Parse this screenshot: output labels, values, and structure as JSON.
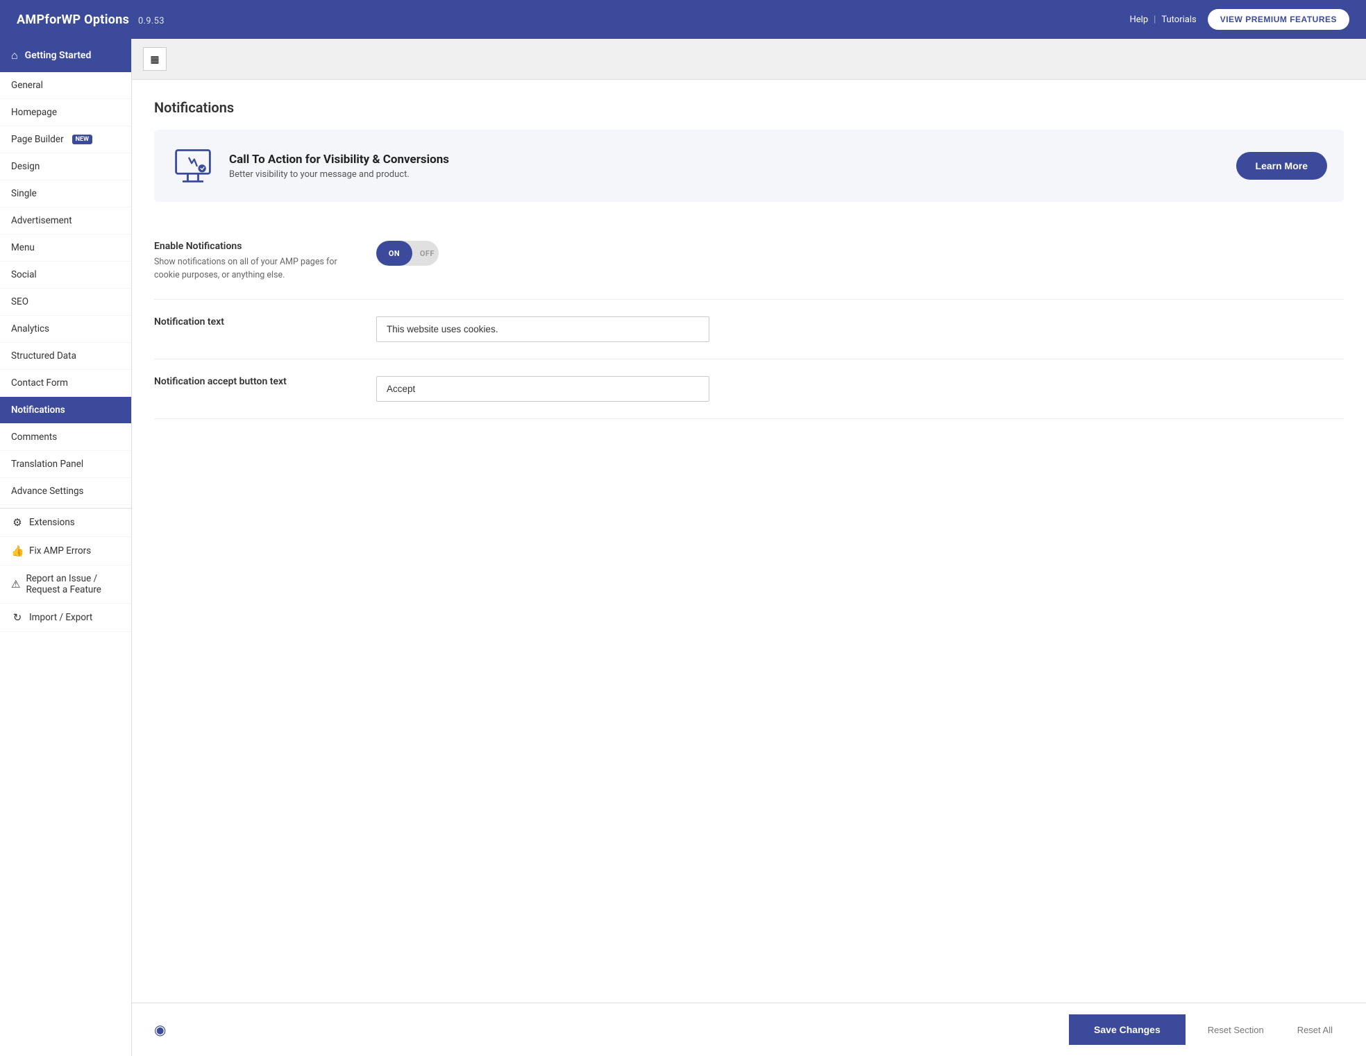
{
  "header": {
    "title": "AMPforWP Options",
    "version": "0.9.53",
    "help_label": "Help",
    "tutorials_label": "Tutorials",
    "view_premium_label": "VIEW PREMIUM FEATURES"
  },
  "sidebar": {
    "getting_started_label": "Getting Started",
    "nav_items": [
      {
        "id": "general",
        "label": "General",
        "active": false,
        "icon": ""
      },
      {
        "id": "homepage",
        "label": "Homepage",
        "active": false,
        "icon": ""
      },
      {
        "id": "page-builder",
        "label": "Page Builder",
        "active": false,
        "icon": "",
        "badge": "NEW"
      },
      {
        "id": "design",
        "label": "Design",
        "active": false,
        "icon": ""
      },
      {
        "id": "single",
        "label": "Single",
        "active": false,
        "icon": ""
      },
      {
        "id": "advertisement",
        "label": "Advertisement",
        "active": false,
        "icon": ""
      },
      {
        "id": "menu",
        "label": "Menu",
        "active": false,
        "icon": ""
      },
      {
        "id": "social",
        "label": "Social",
        "active": false,
        "icon": ""
      },
      {
        "id": "seo",
        "label": "SEO",
        "active": false,
        "icon": ""
      },
      {
        "id": "analytics",
        "label": "Analytics",
        "active": false,
        "icon": ""
      },
      {
        "id": "structured-data",
        "label": "Structured Data",
        "active": false,
        "icon": ""
      },
      {
        "id": "contact-form",
        "label": "Contact Form",
        "active": false,
        "icon": ""
      },
      {
        "id": "notifications",
        "label": "Notifications",
        "active": true,
        "icon": ""
      },
      {
        "id": "comments",
        "label": "Comments",
        "active": false,
        "icon": ""
      },
      {
        "id": "translation-panel",
        "label": "Translation Panel",
        "active": false,
        "icon": ""
      },
      {
        "id": "advance-settings",
        "label": "Advance Settings",
        "active": false,
        "icon": ""
      }
    ],
    "extensions_label": "Extensions",
    "fix_amp_label": "Fix AMP Errors",
    "report_label": "Report an Issue / Request a Feature",
    "import_export_label": "Import / Export"
  },
  "main": {
    "toolbar_icon": "≡",
    "page_title": "Notifications",
    "promo": {
      "heading": "Call To Action for Visibility & Conversions",
      "description": "Better visibility to your message and product.",
      "learn_more_label": "Learn More"
    },
    "settings": [
      {
        "id": "enable-notifications",
        "label": "Enable Notifications",
        "description": "Show notifications on all of your AMP pages for cookie purposes, or anything else.",
        "control_type": "toggle",
        "toggle_on_label": "ON",
        "toggle_off_label": "OFF",
        "toggle_state": "on"
      },
      {
        "id": "notification-text",
        "label": "Notification text",
        "description": "",
        "control_type": "text",
        "value": "This website uses cookies.",
        "placeholder": "This website uses cookies."
      },
      {
        "id": "notification-accept-btn-text",
        "label": "Notification accept button text",
        "description": "",
        "control_type": "text",
        "value": "Accept",
        "placeholder": "Accept"
      }
    ],
    "footer": {
      "save_label": "Save Changes",
      "reset_section_label": "Reset Section",
      "reset_all_label": "Reset All"
    }
  }
}
